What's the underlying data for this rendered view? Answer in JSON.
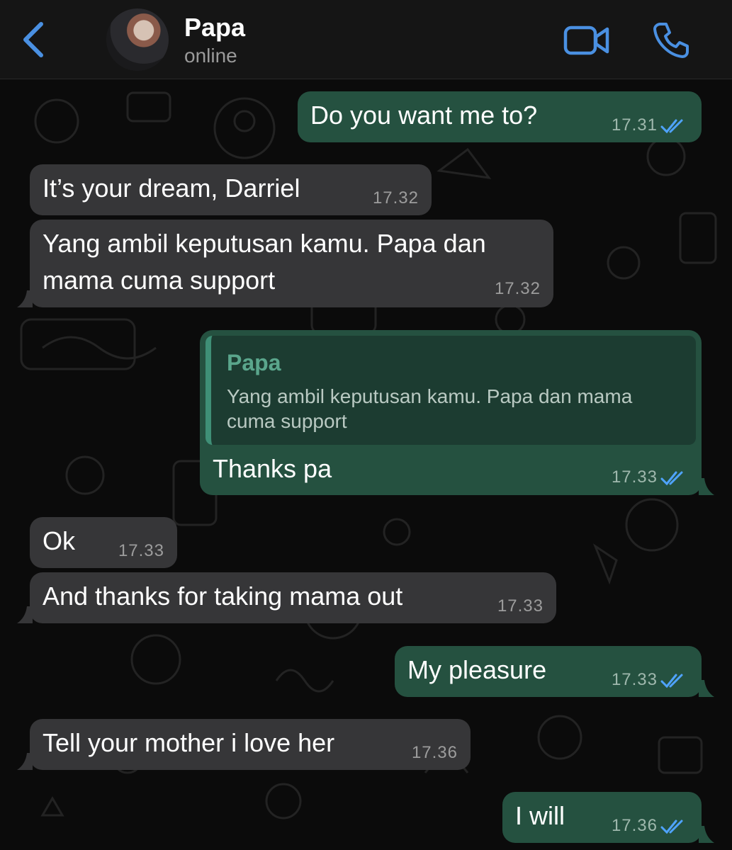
{
  "header": {
    "contact_name": "Papa",
    "status": "online",
    "back_icon": "chevron-left-icon",
    "video_icon": "video-camera-icon",
    "call_icon": "phone-icon"
  },
  "colors": {
    "accent": "#4a90e2",
    "incoming_bubble": "#363638",
    "outgoing_bubble": "#255140",
    "read_ticks": "#4fa3ff",
    "quote_name": "#5aa68c"
  },
  "messages": [
    {
      "direction": "out",
      "text": "Do you want me to?",
      "time": "17.31",
      "read": true
    },
    {
      "direction": "in",
      "text": "It’s your dream, Darriel",
      "time": "17.32"
    },
    {
      "direction": "in",
      "text": "Yang ambil keputusan kamu. Papa dan mama cuma support",
      "time": "17.32"
    },
    {
      "direction": "out",
      "quote_author": "Papa",
      "quote_text": "Yang ambil keputusan kamu. Papa dan mama cuma support",
      "text": "Thanks pa",
      "time": "17.33",
      "read": true
    },
    {
      "direction": "in",
      "text": "Ok",
      "time": "17.33"
    },
    {
      "direction": "in",
      "text": "And thanks for taking mama out",
      "time": "17.33"
    },
    {
      "direction": "out",
      "text": "My pleasure",
      "time": "17.33",
      "read": true
    },
    {
      "direction": "in",
      "text": "Tell your mother i love her",
      "time": "17.36"
    },
    {
      "direction": "out",
      "text": "I will",
      "time": "17.36",
      "read": true
    }
  ]
}
